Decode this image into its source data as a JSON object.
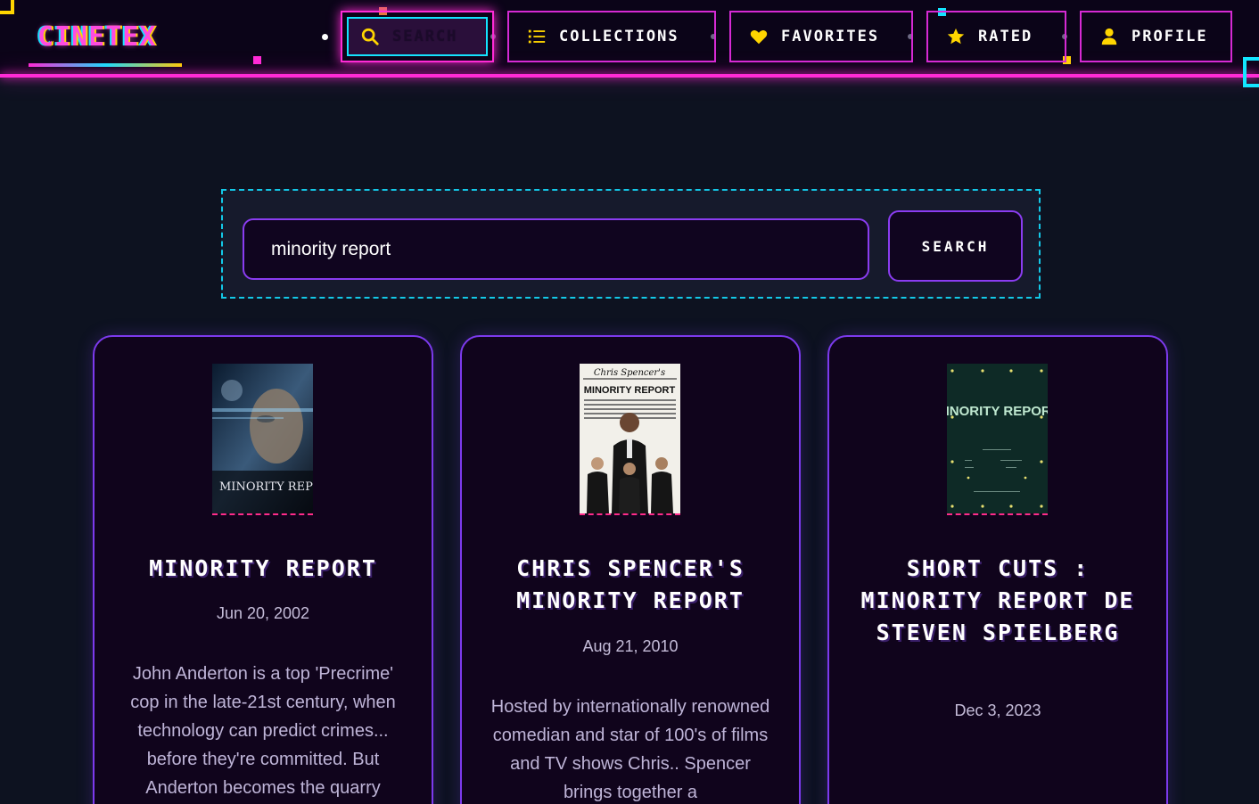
{
  "app": {
    "logo": "CINETEX"
  },
  "nav": {
    "items": [
      {
        "label": "SEARCH",
        "icon": "search-icon",
        "active": true
      },
      {
        "label": "COLLECTIONS",
        "icon": "list-icon",
        "active": false
      },
      {
        "label": "FAVORITES",
        "icon": "heart-icon",
        "active": false
      },
      {
        "label": "RATED",
        "icon": "star-icon",
        "active": false
      },
      {
        "label": "PROFILE",
        "icon": "user-icon",
        "active": false
      }
    ]
  },
  "search": {
    "query": "minority report",
    "button_label": "SEARCH"
  },
  "results": [
    {
      "title": "MINORITY REPORT",
      "date": "Jun 20, 2002",
      "description": "John Anderton is a top 'Precrime' cop in the late-21st century, when technology can predict crimes... before they're committed. But Anderton becomes the quarry",
      "poster_text": "MINORITY REPORT"
    },
    {
      "title": "CHRIS SPENCER'S MINORITY REPORT",
      "date": "Aug 21, 2010",
      "description": "Hosted by internationally renowned comedian and star of 100's of films and TV shows Chris.. Spencer brings together a",
      "poster_text": "MINORITY REPORT",
      "poster_header": "Chris Spencer's"
    },
    {
      "title": "SHORT CUTS : MINORITY REPORT DE STEVEN SPIELBERG",
      "date": "Dec 3, 2023",
      "description": "",
      "poster_text": "MINORITY REPORT"
    }
  ],
  "colors": {
    "accent_pink": "#ff2bd6",
    "accent_cyan": "#13e5ff",
    "accent_yellow": "#ffd500",
    "card_border": "#7c3aed",
    "background": "#0d1220"
  }
}
